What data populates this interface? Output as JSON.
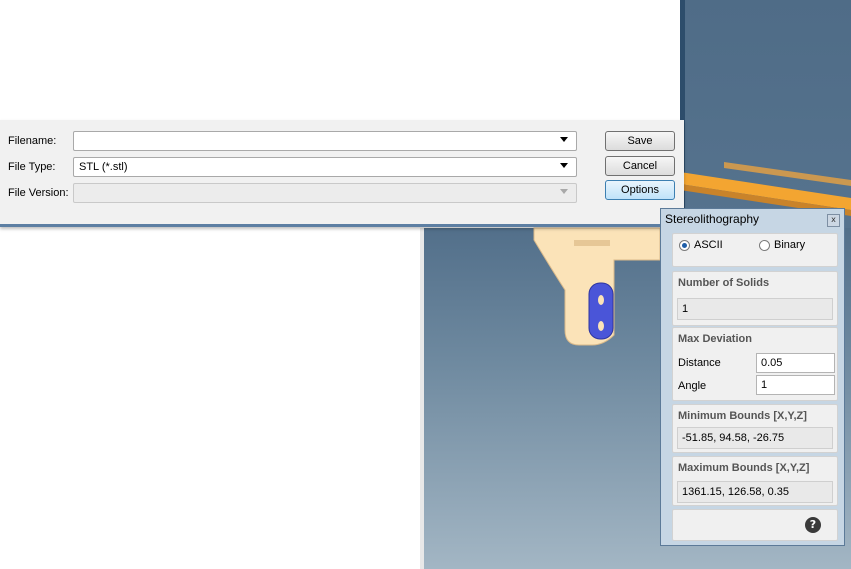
{
  "file_dialog": {
    "filename_label": "Filename:",
    "filename_value": "",
    "filetype_label": "File Type:",
    "filetype_value": "STL (*.stl)",
    "fileversion_label": "File Version:",
    "fileversion_value": "",
    "save_label": "Save",
    "cancel_label": "Cancel",
    "options_label": "Options"
  },
  "stl_panel": {
    "title": "Stereolithography",
    "close_label": "x",
    "format_options": [
      {
        "label": "ASCII",
        "selected": true
      },
      {
        "label": "Binary",
        "selected": false
      }
    ],
    "number_of_solids_label": "Number of Solids",
    "number_of_solids_value": "1",
    "max_deviation_label": "Max Deviation",
    "distance_label": "Distance",
    "distance_value": "0.05",
    "angle_label": "Angle",
    "angle_value": "1",
    "min_bounds_label": "Minimum Bounds [X,Y,Z]",
    "min_bounds_value": "-51.85, 94.58, -26.75",
    "max_bounds_label": "Maximum Bounds [X,Y,Z]",
    "max_bounds_value": "1361.15, 126.58, 0.35",
    "help_label": "?"
  },
  "colors": {
    "viewport_top": "#526f8a",
    "viewport_bottom": "#a3b6c4",
    "model_fill": "#fbe3b8",
    "model_highlight": "#4a55d8",
    "rail_color": "#f3a531"
  }
}
